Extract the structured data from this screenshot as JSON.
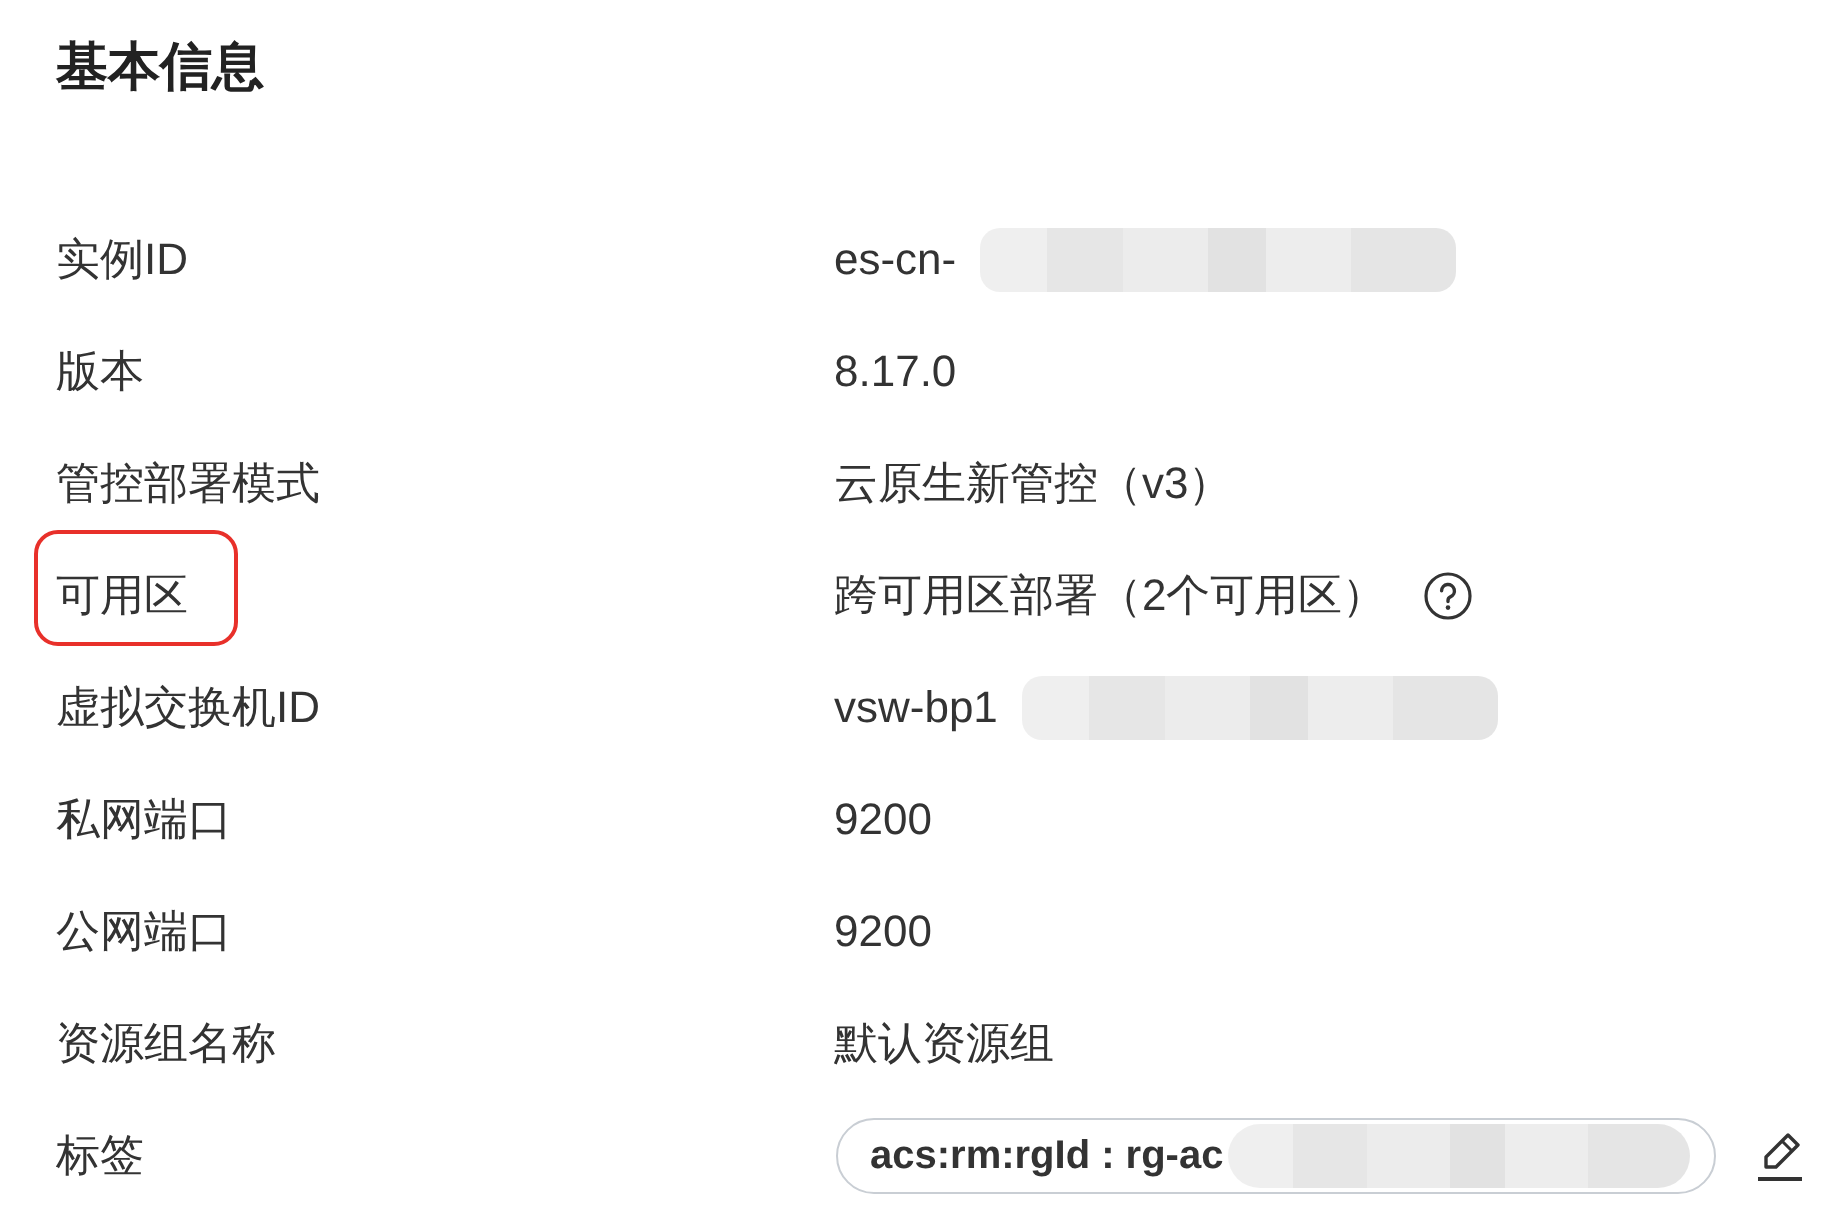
{
  "title": "基本信息",
  "rows": [
    {
      "label": "实例ID",
      "kind": "text",
      "value": "es-cn-",
      "redacted": true,
      "highlighted": false
    },
    {
      "label": "版本",
      "kind": "text",
      "value": "8.17.0",
      "redacted": false,
      "highlighted": false
    },
    {
      "label": "管控部署模式",
      "kind": "text",
      "value": "云原生新管控（v3）",
      "redacted": false,
      "highlighted": false
    },
    {
      "label": "可用区",
      "kind": "help",
      "value": "跨可用区部署（2个可用区）",
      "redacted": false,
      "highlighted": true
    },
    {
      "label": "虚拟交换机ID",
      "kind": "text",
      "value": "vsw-bp1",
      "redacted": true,
      "highlighted": false
    },
    {
      "label": "私网端口",
      "kind": "text",
      "value": "9200",
      "redacted": false,
      "highlighted": false
    },
    {
      "label": "公网端口",
      "kind": "text",
      "value": "9200",
      "redacted": false,
      "highlighted": false
    },
    {
      "label": "资源组名称",
      "kind": "text",
      "value": "默认资源组",
      "redacted": false,
      "highlighted": false
    },
    {
      "label": "标签",
      "kind": "tag",
      "value": "acs:rm:rgId : rg-ac",
      "redacted": true,
      "highlighted": false
    }
  ]
}
